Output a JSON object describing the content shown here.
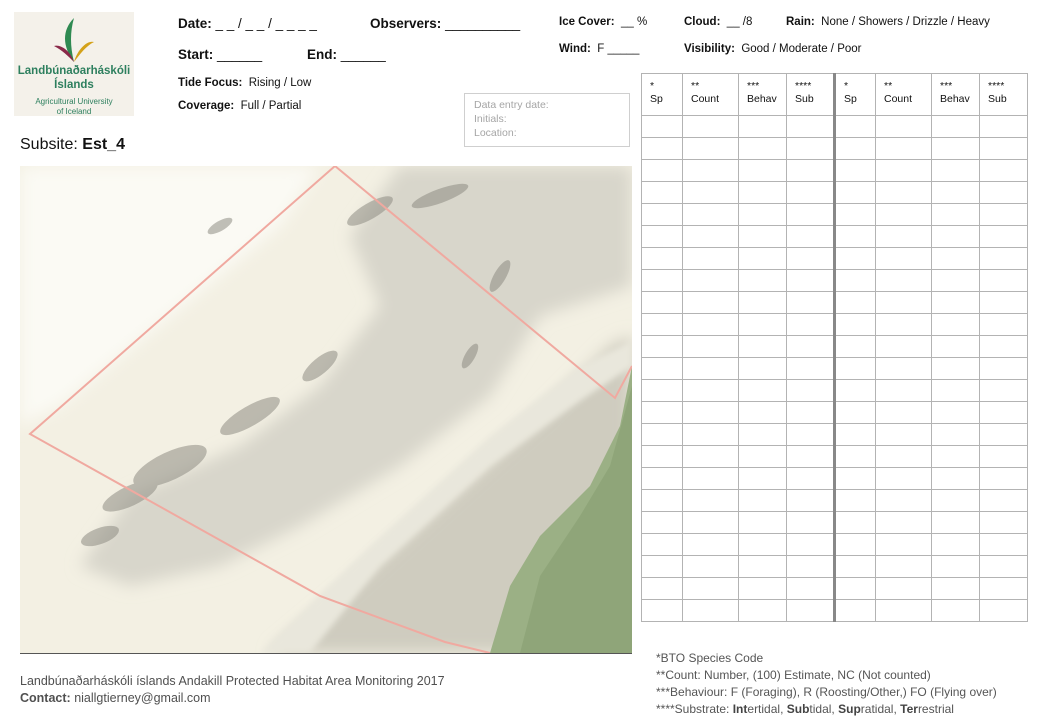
{
  "logo": {
    "line1": "Landbúnaðarháskóli",
    "line2": "Íslands",
    "line3": "Agricultural University",
    "line4": "of Iceland"
  },
  "header": {
    "date_label": "Date:",
    "date_value": "_ _  / _ _  / _ _ _ _",
    "observers_label": "Observers:",
    "observers_value": "__________",
    "start_label": "Start:",
    "start_value": "______",
    "end_label": "End:",
    "end_value": "______",
    "tide_label": "Tide Focus:",
    "tide_value": "Rising  /  Low",
    "coverage_label": "Coverage:",
    "coverage_value": "Full / Partial",
    "ice_label": "Ice Cover:",
    "ice_value": "__  %",
    "cloud_label": "Cloud:",
    "cloud_value": "__  /8",
    "rain_label": "Rain:",
    "rain_value": "None / Showers / Drizzle / Heavy",
    "wind_label": "Wind:",
    "wind_value": "F  _____",
    "visibility_label": "Visibility:",
    "visibility_value": "Good / Moderate / Poor"
  },
  "entry_box": {
    "date": "Data entry date:",
    "initials": "Initials:",
    "location": "Location:"
  },
  "subsite": {
    "label": "Subsite:",
    "value": "Est_4"
  },
  "table": {
    "headers": [
      {
        "stars": "*",
        "label": "Sp"
      },
      {
        "stars": "**",
        "label": "Count"
      },
      {
        "stars": "***",
        "label": "Behav"
      },
      {
        "stars": "****",
        "label": "Sub"
      },
      {
        "stars": "*",
        "label": "Sp"
      },
      {
        "stars": "**",
        "label": "Count"
      },
      {
        "stars": "***",
        "label": "Behav"
      },
      {
        "stars": "****",
        "label": "Sub"
      }
    ]
  },
  "footer": {
    "title": "Landbúnaðarháskóli íslands Andakill Protected Habitat Area Monitoring 2017",
    "contact_label": "Contact:",
    "contact_value": "niallgtierney@gmail.com"
  },
  "notes": {
    "n1": "*BTO Species Code",
    "n2": "**Count: Number, (100) Estimate, NC (Not counted)",
    "n3": "***Behaviour: F (Foraging), R (Roosting/Other,) FO (Flying over)",
    "n4_prefix": "****Substrate: ",
    "n4_int_b": "Int",
    "n4_int_r": "ertidal, ",
    "n4_sub_b": "Sub",
    "n4_sub_r": "tidal, ",
    "n4_sup_b": "Sup",
    "n4_sup_r": "ratidal, ",
    "n4_ter_b": "Ter",
    "n4_ter_r": "restrial"
  },
  "colors": {
    "logo_green": "#2d7f5e",
    "boundary": "#f0a9a0",
    "sand": "#f2efe2",
    "mud": "#c9c7bb",
    "grass": "#8fa57a"
  }
}
